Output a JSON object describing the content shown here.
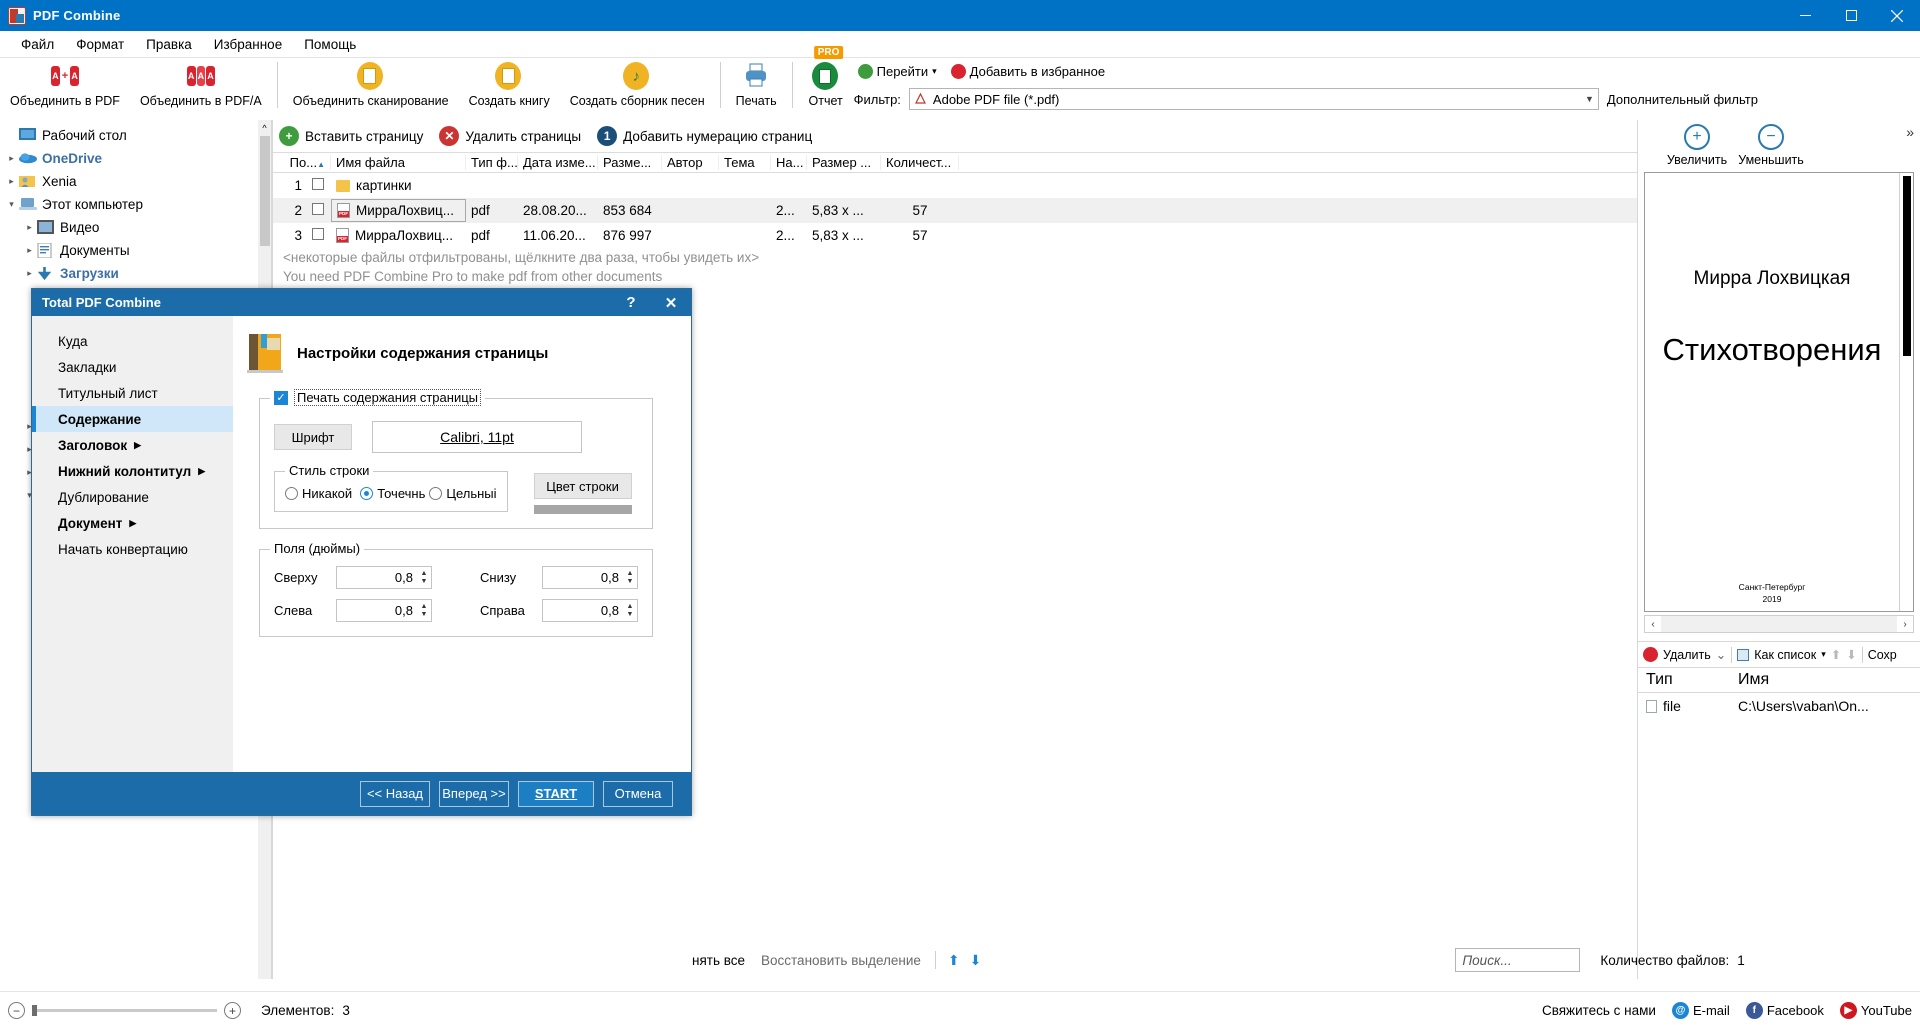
{
  "window": {
    "title": "PDF Combine",
    "app_icon": "pdf-app-icon",
    "minimize": "–",
    "maximize": "❐",
    "close": "✕"
  },
  "menubar": {
    "items": [
      "Файл",
      "Формат",
      "Правка",
      "Избранное",
      "Помощь"
    ]
  },
  "toolbar": {
    "items": [
      {
        "label": "Объединить в PDF",
        "icon": "combine-pdf-icon"
      },
      {
        "label": "Объединить в PDF/A",
        "icon": "combine-pdfa-icon"
      },
      {
        "label": "Объединить сканирование",
        "icon": "combine-scan-icon"
      },
      {
        "label": "Создать книгу",
        "icon": "create-book-icon"
      },
      {
        "label": "Создать сборник песен",
        "icon": "create-songbook-icon"
      },
      {
        "label": "Печать",
        "icon": "print-icon"
      },
      {
        "label": "Отчет",
        "icon": "report-icon",
        "badge": "PRO"
      }
    ],
    "goto": "Перейти",
    "goto_caret": "▾",
    "add_favorite": "Добавить в избранное",
    "filter_label": "Фильтр:",
    "filter_value": "Adobe PDF file (*.pdf)",
    "filter_caret": "▼",
    "extra_filter": "Дополнительный фильтр"
  },
  "sidebar": {
    "items": [
      {
        "label": "Рабочий стол",
        "arrow": "",
        "icon": "desktop-icon",
        "indent": 0,
        "bold": false
      },
      {
        "label": "OneDrive",
        "arrow": "▸",
        "icon": "onedrive-icon",
        "indent": 0,
        "bold": true
      },
      {
        "label": "Xenia",
        "arrow": "▸",
        "icon": "user-folder-icon",
        "indent": 0,
        "bold": false
      },
      {
        "label": "Этот компьютер",
        "arrow": "▾",
        "icon": "computer-icon",
        "indent": 0,
        "bold": false
      },
      {
        "label": "Видео",
        "arrow": "▸",
        "icon": "video-folder-icon",
        "indent": 1,
        "bold": false
      },
      {
        "label": "Документы",
        "arrow": "▸",
        "icon": "documents-folder-icon",
        "indent": 1,
        "bold": false
      },
      {
        "label": "Загрузки",
        "arrow": "▸",
        "icon": "downloads-icon",
        "indent": 1,
        "bold": true
      }
    ],
    "hidden_arrows": [
      "▸",
      "▸",
      "▸",
      "▾"
    ]
  },
  "filelist": {
    "toolbar": [
      {
        "label": "Вставить страницу",
        "icon": "insert-page-icon",
        "color": "#3e9b3e",
        "glyph": "+"
      },
      {
        "label": "Удалить страницы",
        "icon": "delete-pages-icon",
        "color": "#cc3333",
        "glyph": "✕"
      },
      {
        "label": "Добавить нумерацию страниц",
        "icon": "page-numbering-icon",
        "color": "#1a4f7a",
        "glyph": "1"
      }
    ],
    "columns": [
      "По...",
      "Имя файла",
      "Тип ф...",
      "Дата изме...",
      "Разме...",
      "Автор",
      "Тема",
      "На...",
      "Размер ...",
      "Количест..."
    ],
    "sort_marker": "▲",
    "rows": [
      {
        "num": "1",
        "name": "картинки",
        "type": "",
        "date": "",
        "size": "",
        "author": "",
        "subject": "",
        "na": "",
        "dims": "",
        "count": "",
        "icon": "folder-icon",
        "selected": false
      },
      {
        "num": "2",
        "name": "МирраЛохвиц...",
        "type": "pdf",
        "date": "28.08.20...",
        "size": "853 684",
        "author": "",
        "subject": "",
        "na": "2...",
        "dims": "5,83 х ...",
        "count": "57",
        "icon": "pdf-icon",
        "selected": true
      },
      {
        "num": "3",
        "name": "МирраЛохвиц...",
        "type": "pdf",
        "date": "11.06.20...",
        "size": "876 997",
        "author": "",
        "subject": "",
        "na": "2...",
        "dims": "5,83 х ...",
        "count": "57",
        "icon": "pdf-icon",
        "selected": false
      }
    ],
    "note_line1": "<некоторые файлы отфильтрованы, щёлкните два раза, чтобы увидеть их>",
    "note_line2": "You need PDF Combine Pro to make pdf from other documents"
  },
  "preview": {
    "zoom_in": "Увеличить",
    "zoom_out": "Уменьшить",
    "zoom_in_glyph": "+",
    "zoom_out_glyph": "−",
    "expand_glyph": "»",
    "page": {
      "author": "Мирра Лохвицкая",
      "title": "Стихотворения",
      "place": "Санкт-Петербург",
      "year": "2019"
    },
    "hscroll_left": "‹",
    "hscroll_right": "›"
  },
  "files_panel": {
    "delete": "Удалить",
    "delete_caret": "⌄",
    "as_list": "Как список",
    "as_list_caret": "▾",
    "up_arrow": "⬆",
    "down_arrow": "⬇",
    "save": "Сохр",
    "columns": [
      "Тип",
      "Имя"
    ],
    "rows": [
      {
        "type": "file",
        "name": "C:\\Users\\vaban\\On..."
      }
    ],
    "count_label": "Количество файлов:",
    "count_value": "1"
  },
  "dialog": {
    "title": "Total PDF Combine",
    "help_glyph": "?",
    "close_glyph": "✕",
    "nav": [
      {
        "label": "Куда",
        "bold": false,
        "selected": false,
        "arrow": ""
      },
      {
        "label": "Закладки",
        "bold": false,
        "selected": false,
        "arrow": ""
      },
      {
        "label": "Титульный лист",
        "bold": false,
        "selected": false,
        "arrow": ""
      },
      {
        "label": "Содержание",
        "bold": true,
        "selected": true,
        "arrow": ""
      },
      {
        "label": "Заголовок",
        "bold": true,
        "selected": false,
        "arrow": "▶"
      },
      {
        "label": "Нижний колонтитул",
        "bold": true,
        "selected": false,
        "arrow": "▶"
      },
      {
        "label": "Дублирование",
        "bold": false,
        "selected": false,
        "arrow": ""
      },
      {
        "label": "Документ",
        "bold": true,
        "selected": false,
        "arrow": "▶"
      },
      {
        "label": "Начать конвертацию",
        "bold": false,
        "selected": false,
        "arrow": ""
      }
    ],
    "heading": "Настройки содержания страницы",
    "heading_icon": "book-settings-icon",
    "print_toc_checkbox": "Печать содержания страницы",
    "font_button": "Шрифт",
    "font_value": "Calibri, 11pt",
    "line_style_legend": "Стиль строки",
    "line_style_options": [
      {
        "label": "Никакой",
        "selected": false
      },
      {
        "label": "Точечнь",
        "selected": true
      },
      {
        "label": "Цельныі",
        "selected": false
      }
    ],
    "line_color_button": "Цвет строки",
    "line_color_swatch": "#a6a6a6",
    "margins_legend": "Поля (дюймы)",
    "margins": [
      {
        "label": "Сверху",
        "value": "0,8"
      },
      {
        "label": "Снизу",
        "value": "0,8"
      },
      {
        "label": "Слева",
        "value": "0,8"
      },
      {
        "label": "Справа",
        "value": "0,8"
      }
    ],
    "spin_up": "▲",
    "spin_down": "▼",
    "buttons": {
      "back": "<< Назад",
      "next": "Вперед >>",
      "start": "START",
      "cancel": "Отмена"
    }
  },
  "actionbar": {
    "deselect_all": "нять все",
    "restore_selection": "Восстановить выделение",
    "move_up": "⬆",
    "move_down": "⬇",
    "search_placeholder": "Поиск..."
  },
  "statusbar": {
    "zoom_out": "−",
    "zoom_in": "+",
    "elements_label": "Элементов:",
    "elements_value": "3",
    "contact": "Свяжитесь с нами",
    "email": "E-mail",
    "facebook": "Facebook",
    "youtube": "YouTube",
    "email_color": "#1b87d4",
    "facebook_color": "#3b5998",
    "youtube_color": "#cc181e"
  }
}
